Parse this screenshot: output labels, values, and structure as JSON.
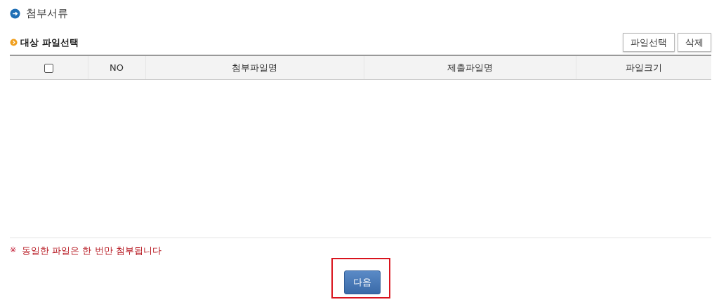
{
  "title": "첨부서류",
  "section": {
    "heading": "대상 파일선택",
    "buttons": [
      "파일선택",
      "삭제"
    ]
  },
  "table": {
    "select_all": {
      "checked": false
    },
    "columns": [
      "NO",
      "첨부파일명",
      "제출파일명",
      "파일크기"
    ]
  },
  "note": {
    "mark": "※",
    "text": "동일한 파일은 한 번만 첨부됩니다"
  },
  "next_button": {
    "label": "다음",
    "highlighted": true
  }
}
